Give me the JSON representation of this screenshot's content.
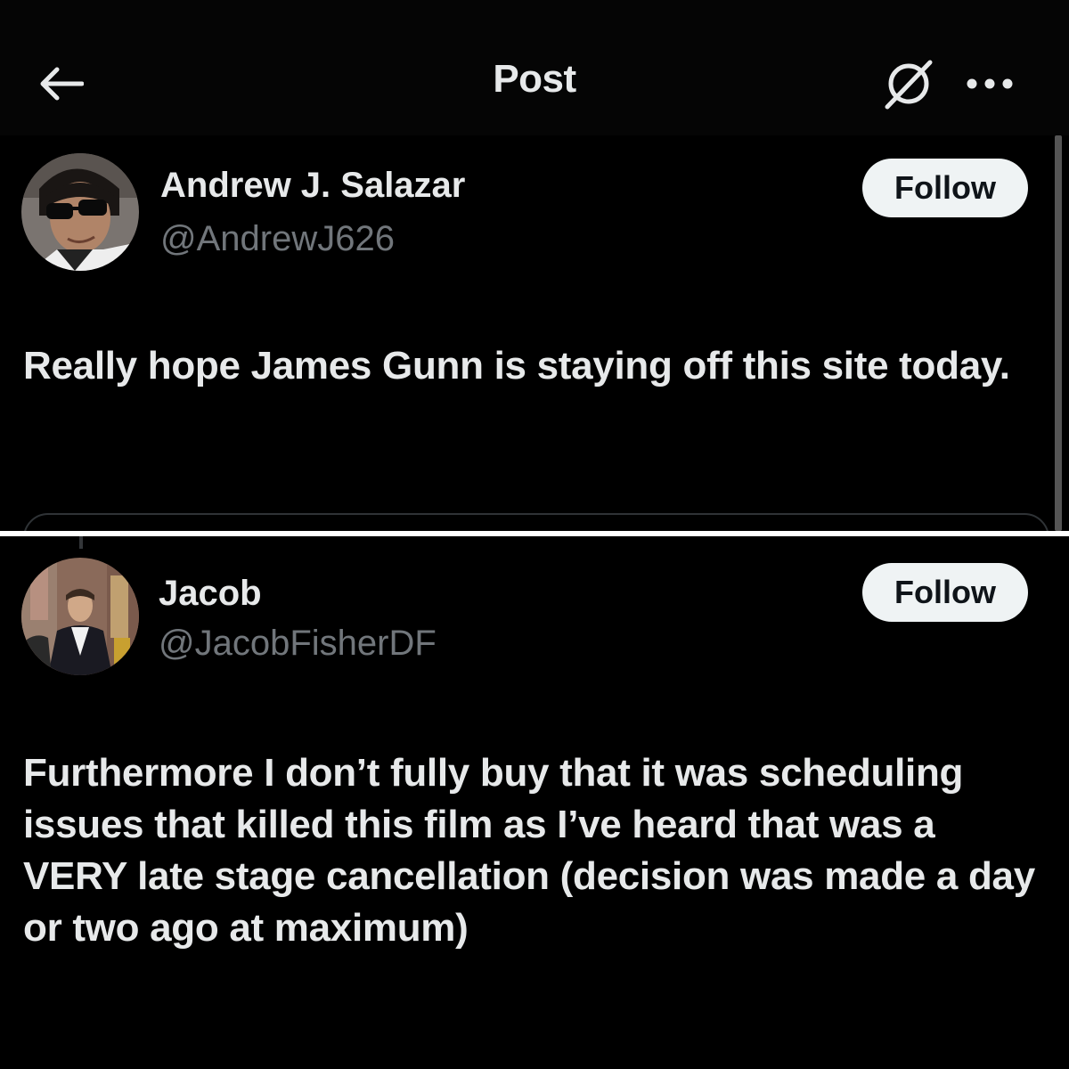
{
  "header": {
    "title": "Post"
  },
  "posts": [
    {
      "display_name": "Andrew J. Salazar",
      "handle": "@AndrewJ626",
      "follow_label": "Follow",
      "text": "Really hope James Gunn is staying off this site today."
    },
    {
      "display_name": "Jacob",
      "handle": "@JacobFisherDF",
      "follow_label": "Follow",
      "text": "Furthermore I don’t fully buy that it was scheduling issues that killed this film as I’ve heard that was a VERY late stage cancellation (decision was made a day or two ago at maximum)"
    }
  ],
  "icons": {
    "back": "back-arrow-icon",
    "grok": "grok-icon",
    "more": "more-icon"
  },
  "colors": {
    "background": "#000000",
    "text_primary": "#e7e9ea",
    "text_secondary": "#71767b",
    "follow_bg": "#eff3f4",
    "follow_text": "#0f1419"
  }
}
